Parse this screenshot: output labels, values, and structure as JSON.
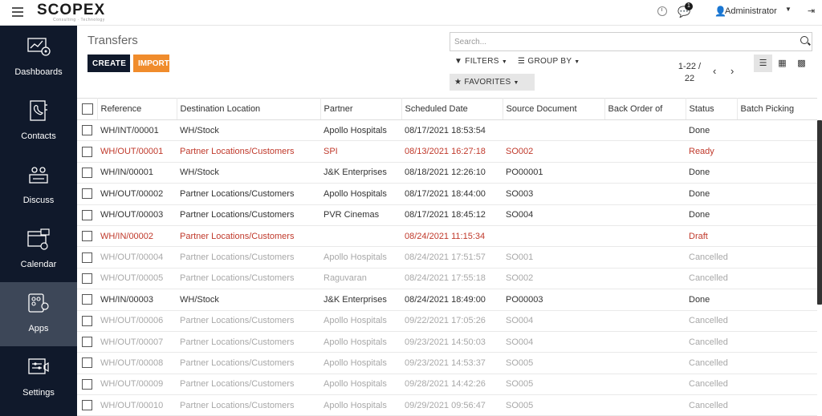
{
  "brand": {
    "logo": "SCOPEX",
    "tagline": "Consulting · Technology"
  },
  "topbar": {
    "notification_count": "1",
    "user": "Administrator"
  },
  "sidebar": {
    "items": [
      {
        "label": "Dashboards",
        "icon": "dashboard-icon"
      },
      {
        "label": "Contacts",
        "icon": "contacts-icon"
      },
      {
        "label": "Discuss",
        "icon": "discuss-icon"
      },
      {
        "label": "Calendar",
        "icon": "calendar-icon"
      },
      {
        "label": "Apps",
        "icon": "apps-icon",
        "active": true
      },
      {
        "label": "Settings",
        "icon": "settings-icon"
      }
    ]
  },
  "header": {
    "title": "Transfers",
    "create_label": "CREATE",
    "import_label": "IMPORT",
    "search_placeholder": "Search...",
    "filters_label": "FILTERS",
    "groupby_label": "GROUP BY",
    "favorites_label": "FAVORITES",
    "pager_range": "1-22 /",
    "pager_total": "22"
  },
  "colors": {
    "sidebar": "#10192b",
    "sidebar_active": "#3d4758",
    "accent_orange": "#f08c2c",
    "alert_red": "#c0392b",
    "muted_gray": "#a8a8a8"
  },
  "table": {
    "columns": [
      "Reference",
      "Destination Location",
      "Partner",
      "Scheduled Date",
      "Source Document",
      "Back Order of",
      "Status",
      "Batch Picking"
    ],
    "rows": [
      {
        "ref": "WH/INT/00001",
        "dest": "WH/Stock",
        "partner": "Apollo Hospitals",
        "date": "08/17/2021 18:53:54",
        "source": "",
        "backorder": "",
        "status": "Done",
        "batch": ""
      },
      {
        "ref": "WH/OUT/00001",
        "dest": "Partner Locations/Customers",
        "partner": "SPI",
        "date": "08/13/2021 16:27:18",
        "source": "SO002",
        "backorder": "",
        "status": "Ready",
        "batch": ""
      },
      {
        "ref": "WH/IN/00001",
        "dest": "WH/Stock",
        "partner": "J&K Enterprises",
        "date": "08/18/2021 12:26:10",
        "source": "PO00001",
        "backorder": "",
        "status": "Done",
        "batch": ""
      },
      {
        "ref": "WH/OUT/00002",
        "dest": "Partner Locations/Customers",
        "partner": "Apollo Hospitals",
        "date": "08/17/2021 18:44:00",
        "source": "SO003",
        "backorder": "",
        "status": "Done",
        "batch": ""
      },
      {
        "ref": "WH/OUT/00003",
        "dest": "Partner Locations/Customers",
        "partner": "PVR Cinemas",
        "date": "08/17/2021 18:45:12",
        "source": "SO004",
        "backorder": "",
        "status": "Done",
        "batch": ""
      },
      {
        "ref": "WH/IN/00002",
        "dest": "Partner Locations/Customers",
        "partner": "",
        "date": "08/24/2021 11:15:34",
        "source": "",
        "backorder": "",
        "status": "Draft",
        "batch": ""
      },
      {
        "ref": "WH/OUT/00004",
        "dest": "Partner Locations/Customers",
        "partner": "Apollo Hospitals",
        "date": "08/24/2021 17:51:57",
        "source": "SO001",
        "backorder": "",
        "status": "Cancelled",
        "batch": ""
      },
      {
        "ref": "WH/OUT/00005",
        "dest": "Partner Locations/Customers",
        "partner": "Raguvaran",
        "date": "08/24/2021 17:55:18",
        "source": "SO002",
        "backorder": "",
        "status": "Cancelled",
        "batch": ""
      },
      {
        "ref": "WH/IN/00003",
        "dest": "WH/Stock",
        "partner": "J&K Enterprises",
        "date": "08/24/2021 18:49:00",
        "source": "PO00003",
        "backorder": "",
        "status": "Done",
        "batch": ""
      },
      {
        "ref": "WH/OUT/00006",
        "dest": "Partner Locations/Customers",
        "partner": "Apollo Hospitals",
        "date": "09/22/2021 17:05:26",
        "source": "SO004",
        "backorder": "",
        "status": "Cancelled",
        "batch": ""
      },
      {
        "ref": "WH/OUT/00007",
        "dest": "Partner Locations/Customers",
        "partner": "Apollo Hospitals",
        "date": "09/23/2021 14:50:03",
        "source": "SO004",
        "backorder": "",
        "status": "Cancelled",
        "batch": ""
      },
      {
        "ref": "WH/OUT/00008",
        "dest": "Partner Locations/Customers",
        "partner": "Apollo Hospitals",
        "date": "09/23/2021 14:53:37",
        "source": "SO005",
        "backorder": "",
        "status": "Cancelled",
        "batch": ""
      },
      {
        "ref": "WH/OUT/00009",
        "dest": "Partner Locations/Customers",
        "partner": "Apollo Hospitals",
        "date": "09/28/2021 14:42:26",
        "source": "SO005",
        "backorder": "",
        "status": "Cancelled",
        "batch": ""
      },
      {
        "ref": "WH/OUT/00010",
        "dest": "Partner Locations/Customers",
        "partner": "Apollo Hospitals",
        "date": "09/29/2021 09:56:47",
        "source": "SO005",
        "backorder": "",
        "status": "Cancelled",
        "batch": ""
      }
    ]
  }
}
